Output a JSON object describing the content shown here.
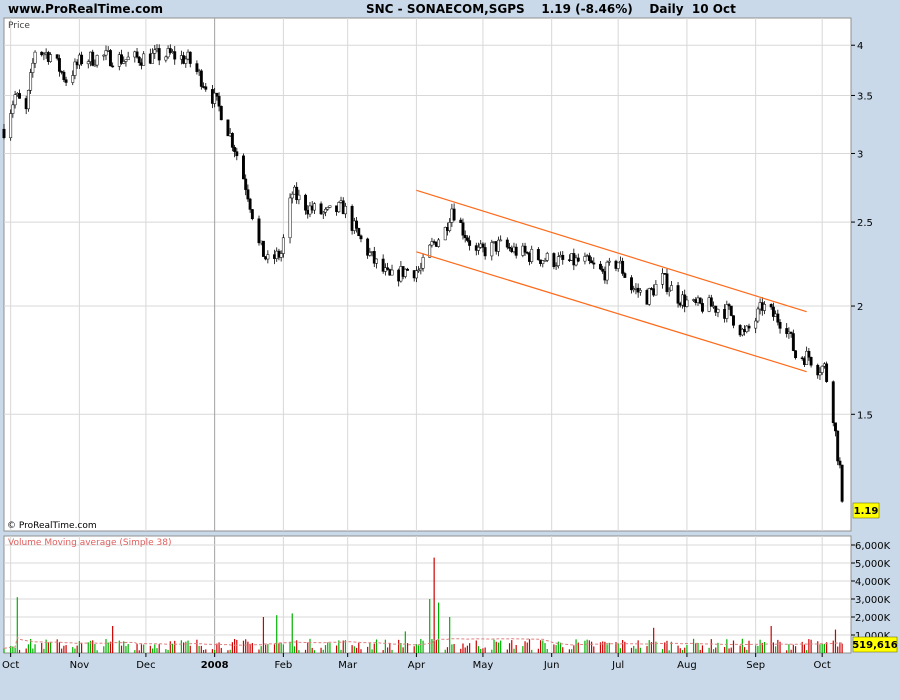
{
  "header": {
    "site": "www.ProRealTime.com",
    "title": "SNC - SONAECOM,SGPS    1.19 (-8.46%)    Daily  10 Oct"
  },
  "price_panel": {
    "label": "Price",
    "watermark": "© ProRealTime.com",
    "last_price_label": "1.19",
    "channel_color": "#ff6a1a"
  },
  "volume_panel": {
    "label": "Volume Moving average (Simple 38)",
    "last_volume_label": "519,616",
    "label_color": "#e06060"
  },
  "colors": {
    "up": "#00b000",
    "down": "#cc0000",
    "badge": "#ffff00",
    "grid": "#d8d8d8"
  },
  "chart_data": [
    {
      "type": "candlestick",
      "scale": "log",
      "ylim": [
        1.1,
        4.3
      ],
      "y_ticks": [
        {
          "label": "4",
          "value": 4
        },
        {
          "label": "3.5",
          "value": 3.5
        },
        {
          "label": "3",
          "value": 3
        },
        {
          "label": "2.5",
          "value": 2.5
        },
        {
          "label": "2",
          "value": 2
        },
        {
          "label": "1.5",
          "value": 1.5
        }
      ],
      "x_range": [
        "2007-09-28",
        "2008-10-14"
      ],
      "x_ticks": [
        {
          "label": "Oct",
          "date": "2007-10-01"
        },
        {
          "label": "Nov",
          "date": "2007-11-01"
        },
        {
          "label": "Dec",
          "date": "2007-12-01"
        },
        {
          "label": "2008",
          "date": "2008-01-01"
        },
        {
          "label": "Feb",
          "date": "2008-02-01"
        },
        {
          "label": "Mar",
          "date": "2008-03-01"
        },
        {
          "label": "Apr",
          "date": "2008-04-01"
        },
        {
          "label": "May",
          "date": "2008-05-01"
        },
        {
          "label": "Jun",
          "date": "2008-06-01"
        },
        {
          "label": "Jul",
          "date": "2008-07-01"
        },
        {
          "label": "Aug",
          "date": "2008-08-01"
        },
        {
          "label": "Sep",
          "date": "2008-09-01"
        },
        {
          "label": "Oct",
          "date": "2008-10-01"
        }
      ],
      "close_trend": [
        [
          "2007-09-28",
          3.2
        ],
        [
          "2007-10-03",
          3.5
        ],
        [
          "2007-10-08",
          3.35
        ],
        [
          "2007-10-12",
          3.95
        ],
        [
          "2007-10-19",
          3.9
        ],
        [
          "2007-10-26",
          3.65
        ],
        [
          "2007-11-02",
          3.85
        ],
        [
          "2007-11-12",
          3.88
        ],
        [
          "2007-11-22",
          3.85
        ],
        [
          "2007-12-03",
          3.88
        ],
        [
          "2007-12-12",
          3.9
        ],
        [
          "2007-12-20",
          3.85
        ],
        [
          "2007-12-28",
          3.6
        ],
        [
          "2008-01-04",
          3.35
        ],
        [
          "2008-01-10",
          3.05
        ],
        [
          "2008-01-16",
          2.7
        ],
        [
          "2008-01-21",
          2.35
        ],
        [
          "2008-01-25",
          2.25
        ],
        [
          "2008-01-31",
          2.3
        ],
        [
          "2008-02-05",
          2.7
        ],
        [
          "2008-02-12",
          2.6
        ],
        [
          "2008-02-20",
          2.55
        ],
        [
          "2008-02-28",
          2.6
        ],
        [
          "2008-03-06",
          2.4
        ],
        [
          "2008-03-13",
          2.25
        ],
        [
          "2008-03-20",
          2.15
        ],
        [
          "2008-03-27",
          2.2
        ],
        [
          "2008-04-03",
          2.2
        ],
        [
          "2008-04-08",
          2.35
        ],
        [
          "2008-04-14",
          2.45
        ],
        [
          "2008-04-17",
          2.6
        ],
        [
          "2008-04-22",
          2.45
        ],
        [
          "2008-04-28",
          2.3
        ],
        [
          "2008-05-08",
          2.35
        ],
        [
          "2008-05-19",
          2.3
        ],
        [
          "2008-05-28",
          2.27
        ],
        [
          "2008-06-06",
          2.25
        ],
        [
          "2008-06-16",
          2.25
        ],
        [
          "2008-06-24",
          2.18
        ],
        [
          "2008-07-01",
          2.25
        ],
        [
          "2008-07-07",
          2.1
        ],
        [
          "2008-07-14",
          2.05
        ],
        [
          "2008-07-21",
          2.15
        ],
        [
          "2008-07-28",
          2.05
        ],
        [
          "2008-08-04",
          2.0
        ],
        [
          "2008-08-12",
          2.0
        ],
        [
          "2008-08-20",
          1.97
        ],
        [
          "2008-08-27",
          1.85
        ],
        [
          "2008-09-01",
          1.93
        ],
        [
          "2008-09-04",
          2.0
        ],
        [
          "2008-09-09",
          1.95
        ],
        [
          "2008-09-15",
          1.9
        ],
        [
          "2008-09-19",
          1.75
        ],
        [
          "2008-09-25",
          1.75
        ],
        [
          "2008-09-29",
          1.7
        ],
        [
          "2008-10-02",
          1.7
        ],
        [
          "2008-10-06",
          1.5
        ],
        [
          "2008-10-08",
          1.35
        ],
        [
          "2008-10-09",
          1.3
        ],
        [
          "2008-10-10",
          1.19
        ]
      ],
      "channel": [
        {
          "from": [
            "2008-04-01",
            2.72
          ],
          "to": [
            "2008-09-24",
            1.97
          ]
        },
        {
          "from": [
            "2008-04-01",
            2.31
          ],
          "to": [
            "2008-09-24",
            1.68
          ]
        }
      ]
    },
    {
      "type": "bar",
      "ylim": [
        0,
        6500000
      ],
      "y_ticks": [
        {
          "label": "6,000K",
          "value": 6000000
        },
        {
          "label": "5,000K",
          "value": 5000000
        },
        {
          "label": "4,000K",
          "value": 4000000
        },
        {
          "label": "3,000K",
          "value": 3000000
        },
        {
          "label": "2,000K",
          "value": 2000000
        },
        {
          "label": "1,000K",
          "value": 1000000
        }
      ],
      "moving_average_period": 38,
      "spikes": [
        [
          "2007-10-04",
          3100000
        ],
        [
          "2007-11-16",
          1500000
        ],
        [
          "2008-01-23",
          2000000
        ],
        [
          "2008-01-29",
          2100000
        ],
        [
          "2008-02-05",
          2200000
        ],
        [
          "2008-03-27",
          1200000
        ],
        [
          "2008-04-07",
          3000000
        ],
        [
          "2008-04-09",
          5300000
        ],
        [
          "2008-04-11",
          2800000
        ],
        [
          "2008-04-16",
          2000000
        ],
        [
          "2008-07-17",
          1400000
        ],
        [
          "2008-09-08",
          1500000
        ],
        [
          "2008-10-07",
          1300000
        ]
      ],
      "last_volume": 519616
    }
  ]
}
